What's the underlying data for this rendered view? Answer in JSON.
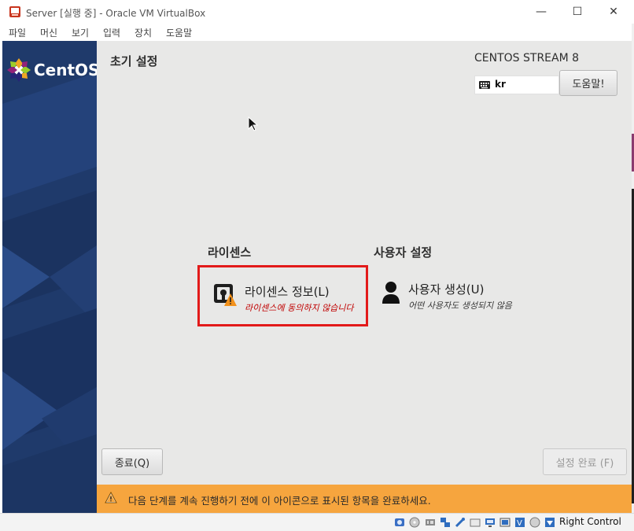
{
  "window": {
    "title": "Server [실행 중] - Oracle VM VirtualBox",
    "minimize_glyph": "—",
    "maximize_glyph": "☐",
    "close_glyph": "✕"
  },
  "menu": {
    "items": [
      "파일",
      "머신",
      "보기",
      "입력",
      "장치",
      "도움말"
    ]
  },
  "guest": {
    "logo_text": "CentOS",
    "page_title": "초기 설정",
    "distro": "CENTOS STREAM 8",
    "keyboard_layout": "kr",
    "help_button": "도움말!",
    "categories": {
      "license": "라이센스",
      "user": "사용자 설정"
    },
    "spokes": {
      "license": {
        "title": "라이센스 정보(L)",
        "status": "라이센스에 동의하지 않습니다"
      },
      "user": {
        "title": "사용자 생성(U)",
        "status": "어떤 사용자도 생성되지 않음"
      }
    },
    "quit_button": "종료(Q)",
    "done_button": "설정 완료 (F)",
    "warning_message": "다음 단계를 계속 진행하기 전에 이 아이콘으로 표시된 항목을 완료하세요."
  },
  "statusbar": {
    "host_key_label": "Right Control"
  },
  "colors": {
    "highlight_box": "#e21a1a",
    "warning_bar": "#f6a53e",
    "sidebar": "#1f3a6b",
    "status_incomplete": "#c00000"
  }
}
